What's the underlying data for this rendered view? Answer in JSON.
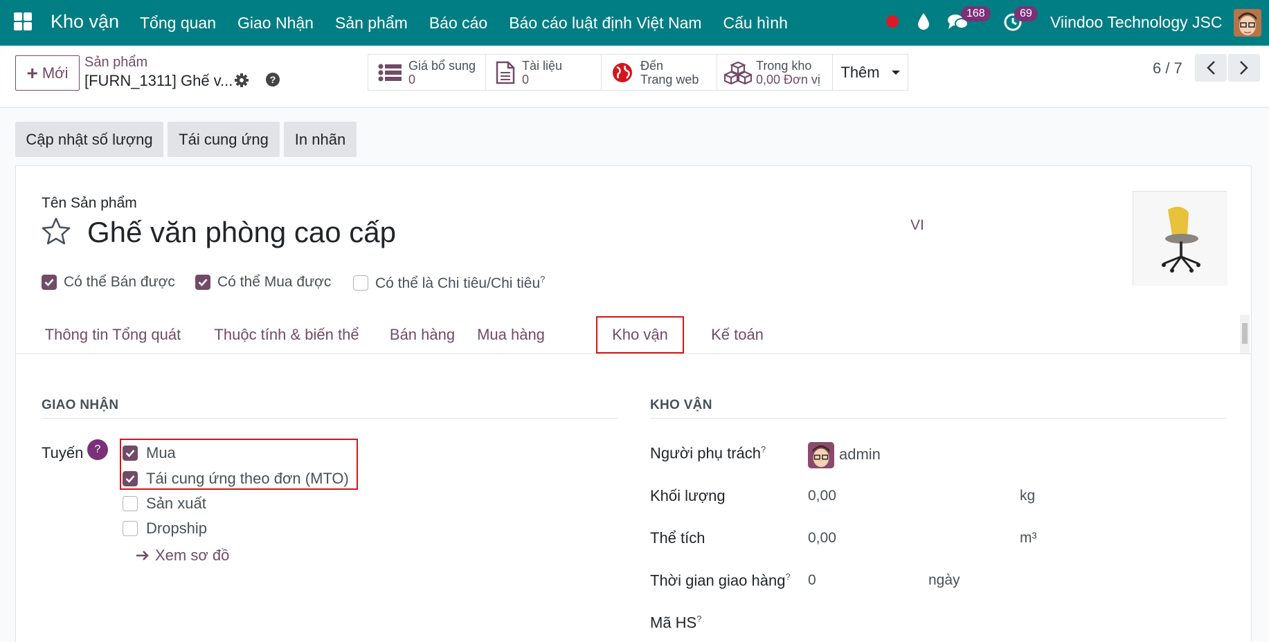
{
  "navbar": {
    "app_name": "Kho vận",
    "menu": [
      "Tổng quan",
      "Giao Nhận",
      "Sản phẩm",
      "Báo cáo",
      "Báo cáo luật định Việt Nam",
      "Cấu hình"
    ],
    "messages_count": "168",
    "activities_count": "69",
    "company": "Viindoo Technology JSC",
    "bg_color": "#017e84"
  },
  "control": {
    "new_button": "Mới",
    "breadcrumb_parent": "Sản phẩm",
    "breadcrumb_current": "[FURN_1311] Ghế v...",
    "smart_buttons": [
      {
        "label": "Giá bổ sung",
        "value": "0",
        "icon": "list-icon"
      },
      {
        "label": "Tài liệu",
        "value": "0",
        "icon": "file-icon"
      },
      {
        "label": "Đến",
        "value": "Trang web",
        "icon": "globe-icon"
      },
      {
        "label": "Trong kho",
        "value": "0,00 Đơn vị",
        "icon": "cubes-icon"
      }
    ],
    "more_button": "Thêm",
    "pager": "6 / 7"
  },
  "actions": [
    "Cập nhật số lượng",
    "Tái cung ứng",
    "In nhãn"
  ],
  "form": {
    "name_label": "Tên Sản phẩm",
    "product_name": "Ghế văn phòng cao cấp",
    "language": "VI",
    "options": [
      {
        "label": "Có thể Bán được",
        "checked": true
      },
      {
        "label": "Có thể Mua được",
        "checked": true
      },
      {
        "label": "Có thể là Chi tiêu/Chi tiêu",
        "checked": false,
        "help": "?"
      }
    ],
    "tabs": [
      "Thông tin Tổng quát",
      "Thuộc tính & biến thể",
      "Bán hàng",
      "Mua hàng",
      "Kho vận",
      "Kế toán"
    ],
    "active_tab": "Kho vận"
  },
  "operations": {
    "title": "GIAO NHẬN",
    "routes_label": "Tuyến",
    "routes_help": "?",
    "routes": [
      {
        "label": "Mua",
        "checked": true
      },
      {
        "label": "Tái cung ứng theo đơn (MTO)",
        "checked": true
      },
      {
        "label": "Sản xuất",
        "checked": false
      },
      {
        "label": "Dropship",
        "checked": false
      }
    ],
    "diagram_link": "Xem sơ đồ"
  },
  "logistics": {
    "title": "KHO VẬN",
    "responsible_label": "Người phụ trách",
    "responsible": "admin",
    "weight_label": "Khối lượng",
    "weight": "0,00",
    "weight_unit": "kg",
    "volume_label": "Thể tích",
    "volume": "0,00",
    "volume_unit": "m³",
    "lead_time_label": "Thời gian giao hàng",
    "lead_time": "0",
    "lead_time_unit": "ngày",
    "hs_code_label": "Mã HS",
    "help_mark": "?"
  },
  "colors": {
    "accent": "#714b67",
    "highlight": "#d7141a",
    "badge": "#7a3178"
  }
}
